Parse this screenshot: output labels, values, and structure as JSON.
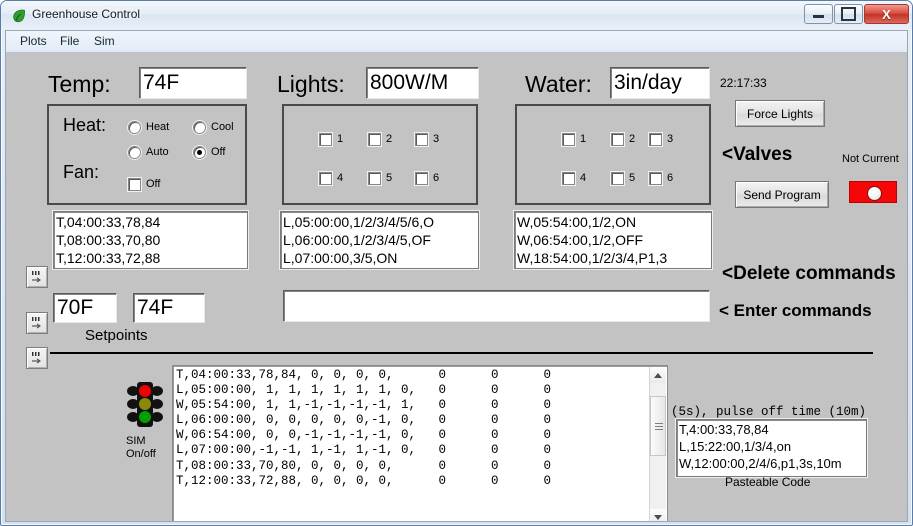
{
  "window": {
    "title": "Greenhouse Control",
    "icon": "leaf-icon",
    "buttons": {
      "minimize": "minimize-icon",
      "maximize": "maximize-icon",
      "close": "X"
    }
  },
  "menu": {
    "items": [
      "Plots",
      "File",
      "Sim"
    ]
  },
  "readouts": {
    "temp": {
      "label": "Temp:",
      "value": "74F"
    },
    "lights": {
      "label": "Lights:",
      "value": "800W/M"
    },
    "water": {
      "label": "Water:",
      "value": "3in/day"
    }
  },
  "clock": "22:17:33",
  "heat_panel": {
    "heat_label": "Heat:",
    "fan_label": "Fan:",
    "radios": [
      {
        "label": "Heat",
        "selected": false
      },
      {
        "label": "Cool",
        "selected": false
      },
      {
        "label": "Auto",
        "selected": false
      },
      {
        "label": "Off",
        "selected": true
      }
    ],
    "fan_checkbox": {
      "label": "Off",
      "checked": false
    }
  },
  "lights_panel": {
    "checkboxes": [
      {
        "label": "1",
        "checked": false
      },
      {
        "label": "2",
        "checked": false
      },
      {
        "label": "3",
        "checked": false
      },
      {
        "label": "4",
        "checked": false
      },
      {
        "label": "5",
        "checked": false
      },
      {
        "label": "6",
        "checked": false
      }
    ]
  },
  "water_panel": {
    "checkboxes": [
      {
        "label": "1",
        "checked": false
      },
      {
        "label": "2",
        "checked": false
      },
      {
        "label": "3",
        "checked": false
      },
      {
        "label": "4",
        "checked": false
      },
      {
        "label": "5",
        "checked": false
      },
      {
        "label": "6",
        "checked": false
      }
    ]
  },
  "temp_commands": [
    "T,04:00:33,78,84",
    "T,08:00:33,70,80",
    "T,12:00:33,72,88"
  ],
  "light_commands": [
    "L,05:00:00,1/2/3/4/5/6,O",
    "L,06:00:00,1/2/3/4/5,OF",
    "L,07:00:00,3/5,ON"
  ],
  "water_commands": [
    "W,05:54:00,1/2,ON",
    "W,06:54:00,1/2,OFF",
    "W,18:54:00,1/2/3/4,P1,3"
  ],
  "annotations": {
    "valves": "<Valves",
    "delete_commands": "<Delete commands",
    "enter_commands": "< Enter commands",
    "setpoints": "Setpoints",
    "pasteable_code": "Pasteable Code",
    "not_current": "Not Current"
  },
  "buttons": {
    "force_lights": "Force Lights",
    "send_program": "Send Program"
  },
  "setpoints": {
    "low": "70F",
    "high": "74F"
  },
  "command_input": {
    "value": "",
    "placeholder": ""
  },
  "sim": {
    "label_line1": "SIM",
    "label_line2": "On/off",
    "icon": "traffic-light-icon"
  },
  "log": {
    "lines": [
      "T,04:00:33,78,84, 0, 0, 0, 0,      0      0      0",
      "L,05:00:00, 1, 1, 1, 1, 1, 1, 0,   0      0      0",
      "W,05:54:00, 1, 1,-1,-1,-1,-1, 1,   0      0      0",
      "L,06:00:00, 0, 0, 0, 0, 0,-1, 0,   0      0      0",
      "W,06:54:00, 0, 0,-1,-1,-1,-1, 0,   0      0      0",
      "L,07:00:00,-1,-1, 1,-1, 1,-1, 0,   0      0      0",
      "T,08:00:33,70,80, 0, 0, 0, 0,      0      0      0",
      "T,12:00:33,72,88, 0, 0, 0, 0,      0      0      0"
    ]
  },
  "hidden_hint": "n (5s), pulse off time (10m)",
  "pasteable": [
    "T,4:00:33,78,84",
    "L,15:22:00,1/3/4,on",
    "W,12:00:00,2/4/6,p1,3s,10m"
  ],
  "colors": {
    "status_red": "#f60606",
    "window_bg": "#c3c3c3",
    "traffic_red": "#f00000",
    "traffic_yellow": "#8a8a08",
    "traffic_green": "#00a000"
  }
}
